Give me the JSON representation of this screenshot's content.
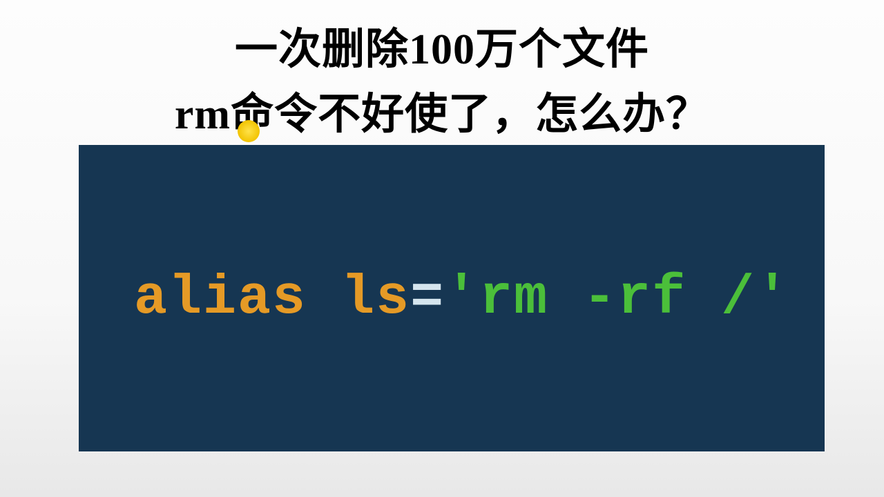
{
  "title": {
    "line1": "一次删除100万个文件",
    "line2": "rm命令不好使了，怎么办？"
  },
  "code": {
    "keyword": "alias",
    "space1": " ",
    "name": "ls",
    "equals": "=",
    "string": "'rm -rf /'"
  }
}
